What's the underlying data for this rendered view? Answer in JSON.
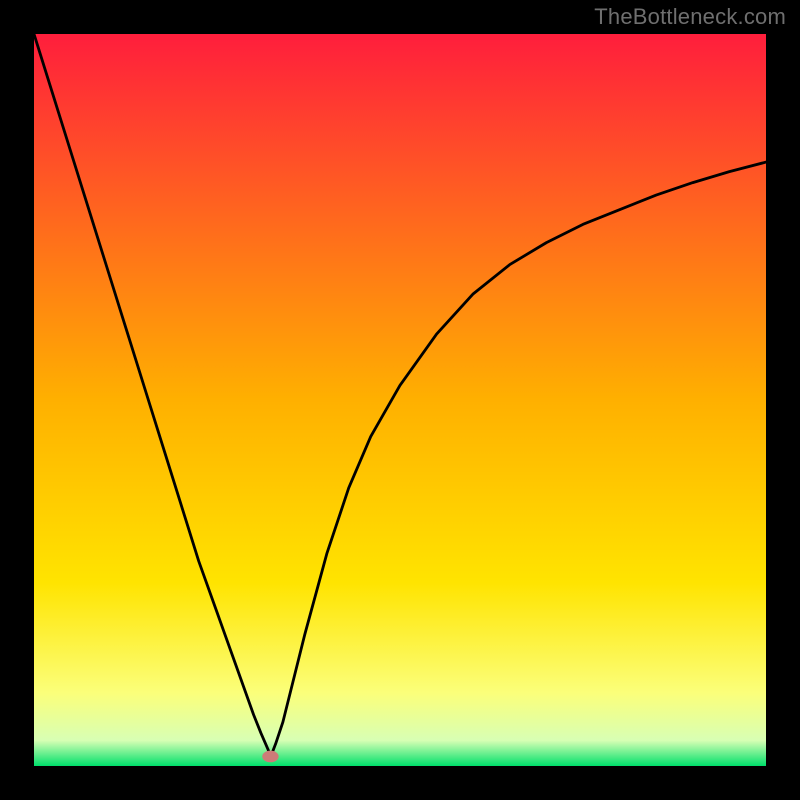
{
  "watermark": "TheBottleneck.com",
  "chart_data": {
    "type": "line",
    "title": "",
    "xlabel": "",
    "ylabel": "",
    "xlim": [
      0,
      100
    ],
    "ylim": [
      0,
      100
    ],
    "background_gradient": {
      "top_color": "#ff1e3c",
      "mid_color": "#ffd200",
      "lower_mid_color": "#fffc6a",
      "bottom_color": "#00e06b"
    },
    "marker": {
      "x": 32.3,
      "y": 1.3,
      "color": "#cd7c78"
    },
    "series": [
      {
        "name": "curve",
        "x": [
          0,
          2.5,
          5,
          7.5,
          10,
          12.5,
          15,
          17.5,
          20,
          22.5,
          25,
          27.5,
          30,
          31,
          32,
          32.3,
          33,
          34,
          35,
          37,
          40,
          43,
          46,
          50,
          55,
          60,
          65,
          70,
          75,
          80,
          85,
          90,
          95,
          100
        ],
        "y": [
          100,
          92,
          84,
          76,
          68,
          60,
          52,
          44,
          36,
          28,
          21,
          14,
          7,
          4.5,
          2.2,
          1.2,
          3,
          6,
          10,
          18,
          29,
          38,
          45,
          52,
          59,
          64.5,
          68.5,
          71.5,
          74,
          76,
          78,
          79.7,
          81.2,
          82.5
        ]
      }
    ]
  }
}
